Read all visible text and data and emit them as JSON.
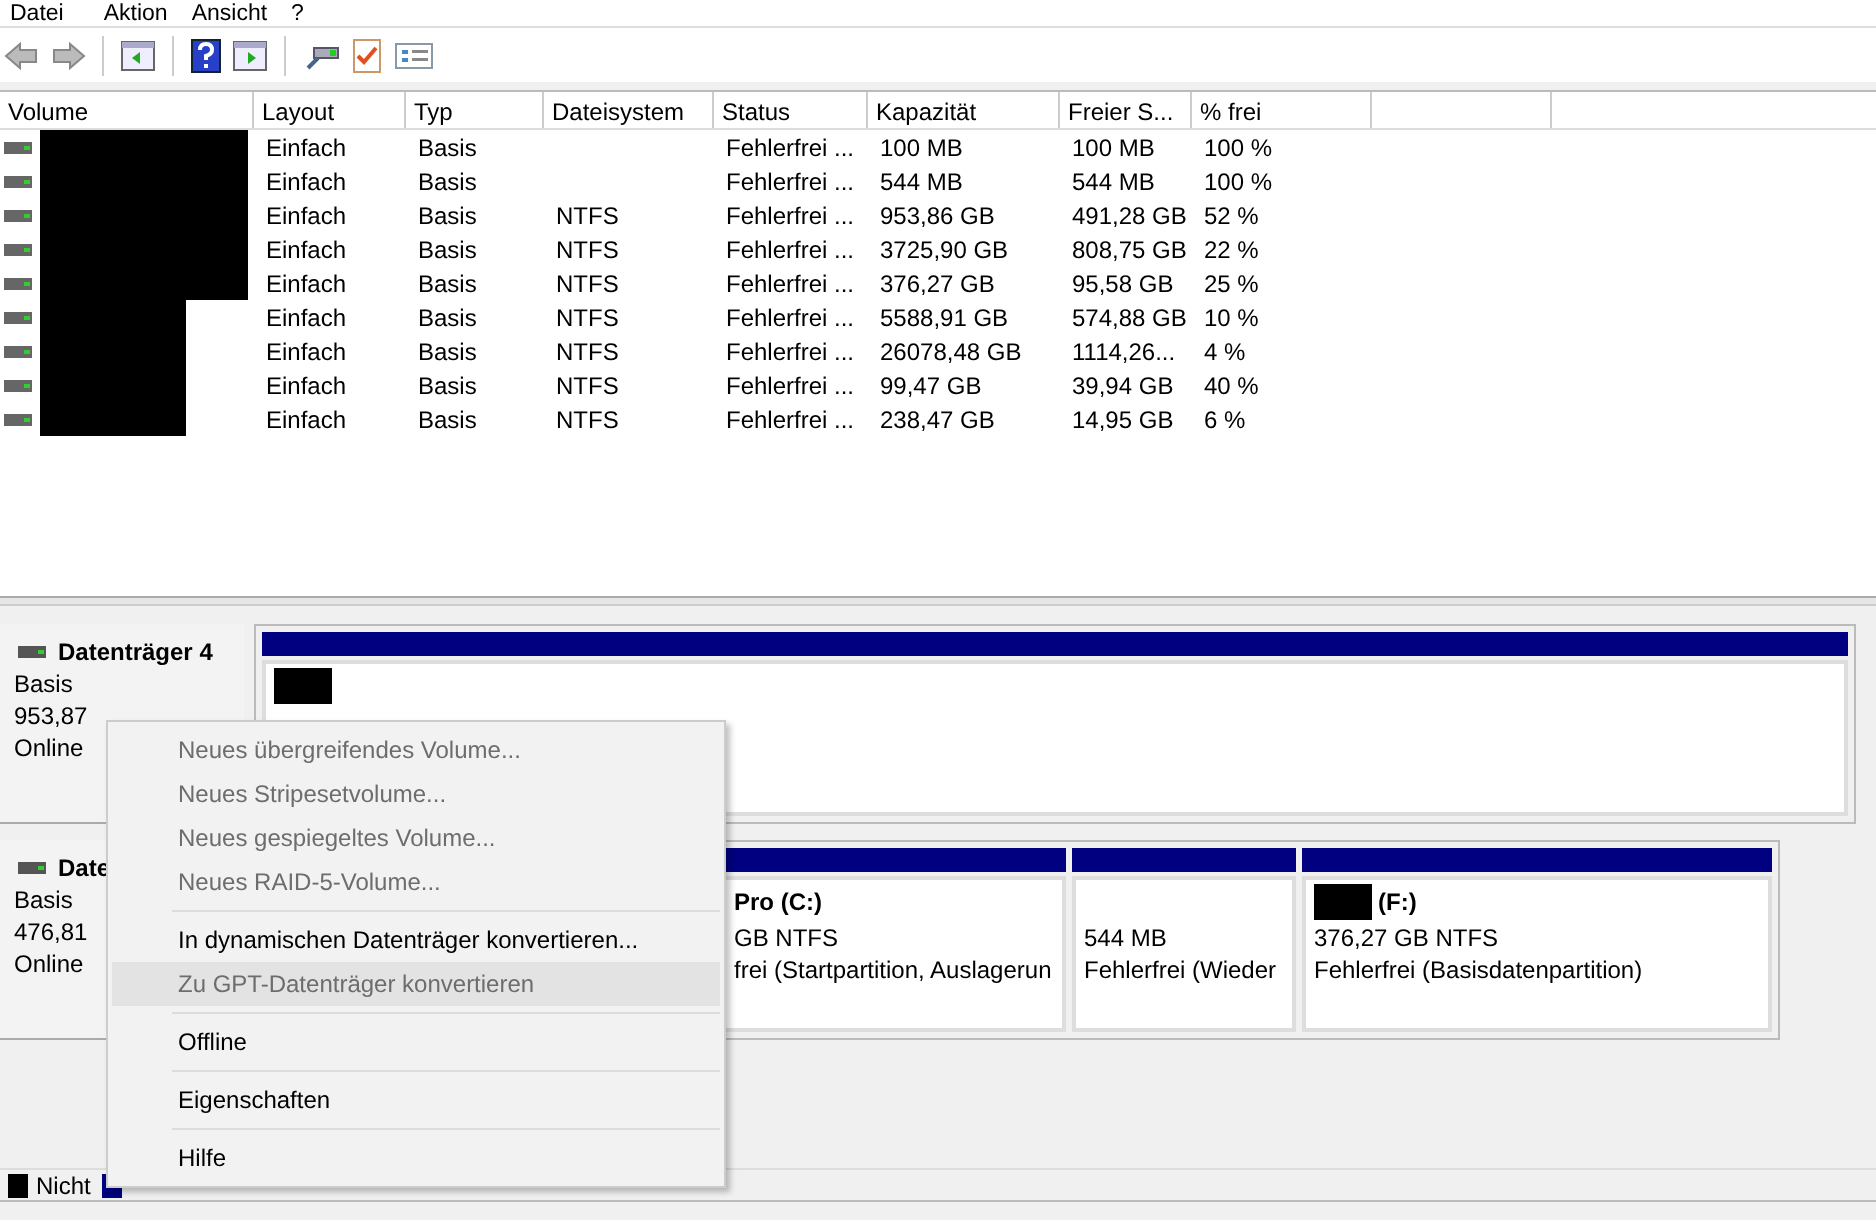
{
  "menu_bar": [
    "Datei",
    "Aktion",
    "Ansicht",
    "?"
  ],
  "volume_table": {
    "columns": [
      "Volume",
      "Layout",
      "Typ",
      "Dateisystem",
      "Status",
      "Kapazität",
      "Freier S...",
      "% frei"
    ],
    "rows": [
      {
        "wide": true,
        "layout": "Einfach",
        "type": "Basis",
        "status": "Fehlerfrei ...",
        "capacity": "100 MB",
        "free": "100 MB",
        "free_pct": "100 %"
      },
      {
        "wide": true,
        "layout": "Einfach",
        "type": "Basis",
        "status": "Fehlerfrei ...",
        "capacity": "544 MB",
        "free": "544 MB",
        "free_pct": "100 %"
      },
      {
        "wide": true,
        "layout": "Einfach",
        "type": "Basis",
        "file_system": "NTFS",
        "status": "Fehlerfrei ...",
        "capacity": "953,86 GB",
        "free": "491,28 GB",
        "free_pct": "52 %"
      },
      {
        "wide": true,
        "layout": "Einfach",
        "type": "Basis",
        "file_system": "NTFS",
        "status": "Fehlerfrei ...",
        "capacity": "3725,90 GB",
        "free": "808,75 GB",
        "free_pct": "22 %"
      },
      {
        "wide": true,
        "layout": "Einfach",
        "type": "Basis",
        "file_system": "NTFS",
        "status": "Fehlerfrei ...",
        "capacity": "376,27 GB",
        "free": "95,58 GB",
        "free_pct": "25 %"
      },
      {
        "wide": false,
        "layout": "Einfach",
        "type": "Basis",
        "file_system": "NTFS",
        "status": "Fehlerfrei ...",
        "capacity": "5588,91 GB",
        "free": "574,88 GB",
        "free_pct": "10 %"
      },
      {
        "wide": false,
        "layout": "Einfach",
        "type": "Basis",
        "file_system": "NTFS",
        "status": "Fehlerfrei ...",
        "capacity": "26078,48 GB",
        "free": "1114,26...",
        "free_pct": "4 %"
      },
      {
        "wide": false,
        "layout": "Einfach",
        "type": "Basis",
        "file_system": "NTFS",
        "status": "Fehlerfrei ...",
        "capacity": "99,47 GB",
        "free": "39,94 GB",
        "free_pct": "40 %"
      },
      {
        "wide": false,
        "layout": "Einfach",
        "type": "Basis",
        "file_system": "NTFS",
        "status": "Fehlerfrei ...",
        "capacity": "238,47 GB",
        "free": "14,95 GB",
        "free_pct": "6 %"
      }
    ]
  },
  "disks": [
    {
      "name": "Datenträger 4",
      "type": "Basis",
      "size": "953,87",
      "state": "Online",
      "partitions": [
        {
          "redacted": true
        }
      ]
    },
    {
      "name": "Date",
      "type": "Basis",
      "size": "476,81",
      "state": "Online",
      "partitions": [
        {
          "redacted": false,
          "name": "Pro  (C:)",
          "size_fs": "GB NTFS",
          "status": "frei (Startpartition, Auslagerun"
        },
        {
          "redacted": false,
          "size_fs": "544 MB",
          "status": "Fehlerfrei (Wieder"
        },
        {
          "redacted": true,
          "name": "(F:)",
          "size_fs": "376,27 GB NTFS",
          "status": "Fehlerfrei (Basisdatenpartition)"
        }
      ]
    }
  ],
  "legend": [
    {
      "label": "Nicht",
      "color": "#000000"
    },
    {
      "color": "#000080"
    }
  ],
  "context_menu": [
    {
      "kind": "item",
      "label": "Neues übergreifendes Volume...",
      "disabled": true,
      "highlighted": false
    },
    {
      "kind": "item",
      "label": "Neues Stripesetvolume...",
      "disabled": true,
      "highlighted": false
    },
    {
      "kind": "item",
      "label": "Neues gespiegeltes Volume...",
      "disabled": true,
      "highlighted": false
    },
    {
      "kind": "item",
      "label": "Neues RAID-5-Volume...",
      "disabled": true,
      "highlighted": false
    },
    {
      "kind": "separator"
    },
    {
      "kind": "item",
      "label": "In dynamischen Datenträger konvertieren...",
      "disabled": false,
      "highlighted": false
    },
    {
      "kind": "item",
      "label": "Zu GPT-Datenträger konvertieren",
      "disabled": true,
      "highlighted": true
    },
    {
      "kind": "separator"
    },
    {
      "kind": "item",
      "label": "Offline",
      "disabled": false,
      "highlighted": false
    },
    {
      "kind": "separator"
    },
    {
      "kind": "item",
      "label": "Eigenschaften",
      "disabled": false,
      "highlighted": false
    },
    {
      "kind": "separator"
    },
    {
      "kind": "item",
      "label": "Hilfe",
      "disabled": false,
      "highlighted": false
    }
  ]
}
